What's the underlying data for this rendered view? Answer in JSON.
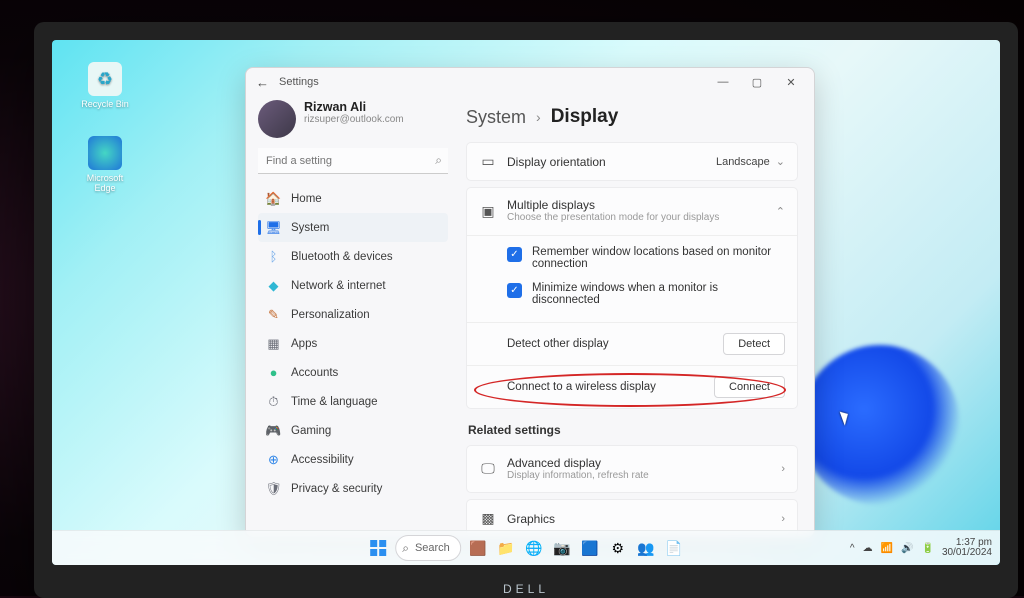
{
  "desktop": {
    "icons": [
      {
        "name": "recycle-bin",
        "label": "Recycle Bin"
      },
      {
        "name": "edge",
        "label": "Microsoft Edge"
      }
    ]
  },
  "window": {
    "app_name": "Settings",
    "controls": {
      "min": "—",
      "max": "▢",
      "close": "✕"
    }
  },
  "user": {
    "name": "Rizwan Ali",
    "email": "rizsuper@outlook.com"
  },
  "search": {
    "placeholder": "Find a setting"
  },
  "sidebar": {
    "items": [
      {
        "label": "Home",
        "icon": "🏠",
        "color": "#39a0e6"
      },
      {
        "label": "System",
        "icon": "🖥",
        "color": "#1f6fe8",
        "active": true
      },
      {
        "label": "Bluetooth & devices",
        "icon": "ᛒ",
        "color": "#6aa6e8"
      },
      {
        "label": "Network & internet",
        "icon": "◆",
        "color": "#2fb7d4"
      },
      {
        "label": "Personalization",
        "icon": "✎",
        "color": "#c36a2e"
      },
      {
        "label": "Apps",
        "icon": "▦",
        "color": "#6b6e78"
      },
      {
        "label": "Accounts",
        "icon": "●",
        "color": "#2fc08a"
      },
      {
        "label": "Time & language",
        "icon": "⏱",
        "color": "#6b6e78"
      },
      {
        "label": "Gaming",
        "icon": "🎮",
        "color": "#6b6e78"
      },
      {
        "label": "Accessibility",
        "icon": "⊕",
        "color": "#2f86e8"
      },
      {
        "label": "Privacy & security",
        "icon": "🛡",
        "color": "#6b6e78"
      }
    ]
  },
  "breadcrumb": {
    "root": "System",
    "sep": "›",
    "page": "Display"
  },
  "rows": {
    "orientation": {
      "label": "Display orientation",
      "value": "Landscape"
    },
    "multiple": {
      "label": "Multiple displays",
      "sub": "Choose the presentation mode for your displays"
    },
    "checks": [
      {
        "label": "Remember window locations based on monitor connection",
        "checked": true
      },
      {
        "label": "Minimize windows when a monitor is disconnected",
        "checked": true
      }
    ],
    "detect": {
      "label": "Detect other display",
      "button": "Detect"
    },
    "wireless": {
      "label": "Connect to a wireless display",
      "button": "Connect"
    },
    "related_heading": "Related settings",
    "advanced": {
      "label": "Advanced display",
      "sub": "Display information, refresh rate"
    },
    "graphics": {
      "label": "Graphics"
    }
  },
  "taskbar": {
    "search": "Search",
    "time": "1:37 pm",
    "date": "30/01/2024"
  },
  "brand": "DELL"
}
